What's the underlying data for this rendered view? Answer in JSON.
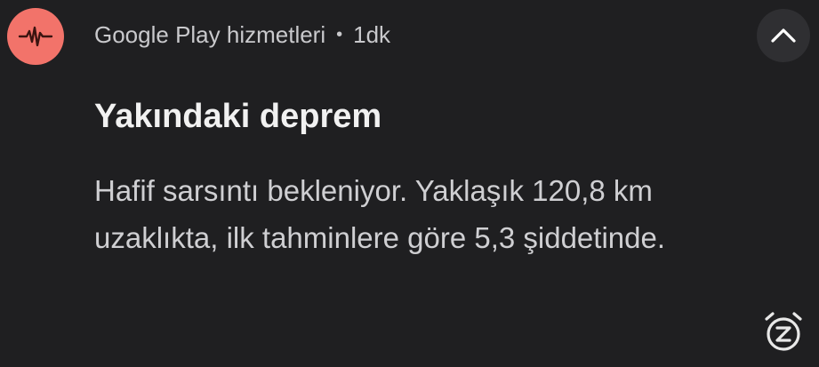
{
  "notification": {
    "app_name": "Google Play hizmetleri",
    "separator": "•",
    "time": "1dk",
    "title": "Yakındaki deprem",
    "body_line1": "Hafif sarsıntı bekleniyor. Yaklaşık 120,8 km",
    "body_line2": "uzaklıkta, ilk tahminlere göre 5,3 şiddetinde.",
    "icons": {
      "app": "seismograph-icon",
      "expand": "chevron-up-icon",
      "snooze": "snooze-icon"
    },
    "colors": {
      "background": "#1f1f21",
      "app_icon_bg": "#f2736a",
      "expand_bg": "#2f2f32"
    }
  }
}
